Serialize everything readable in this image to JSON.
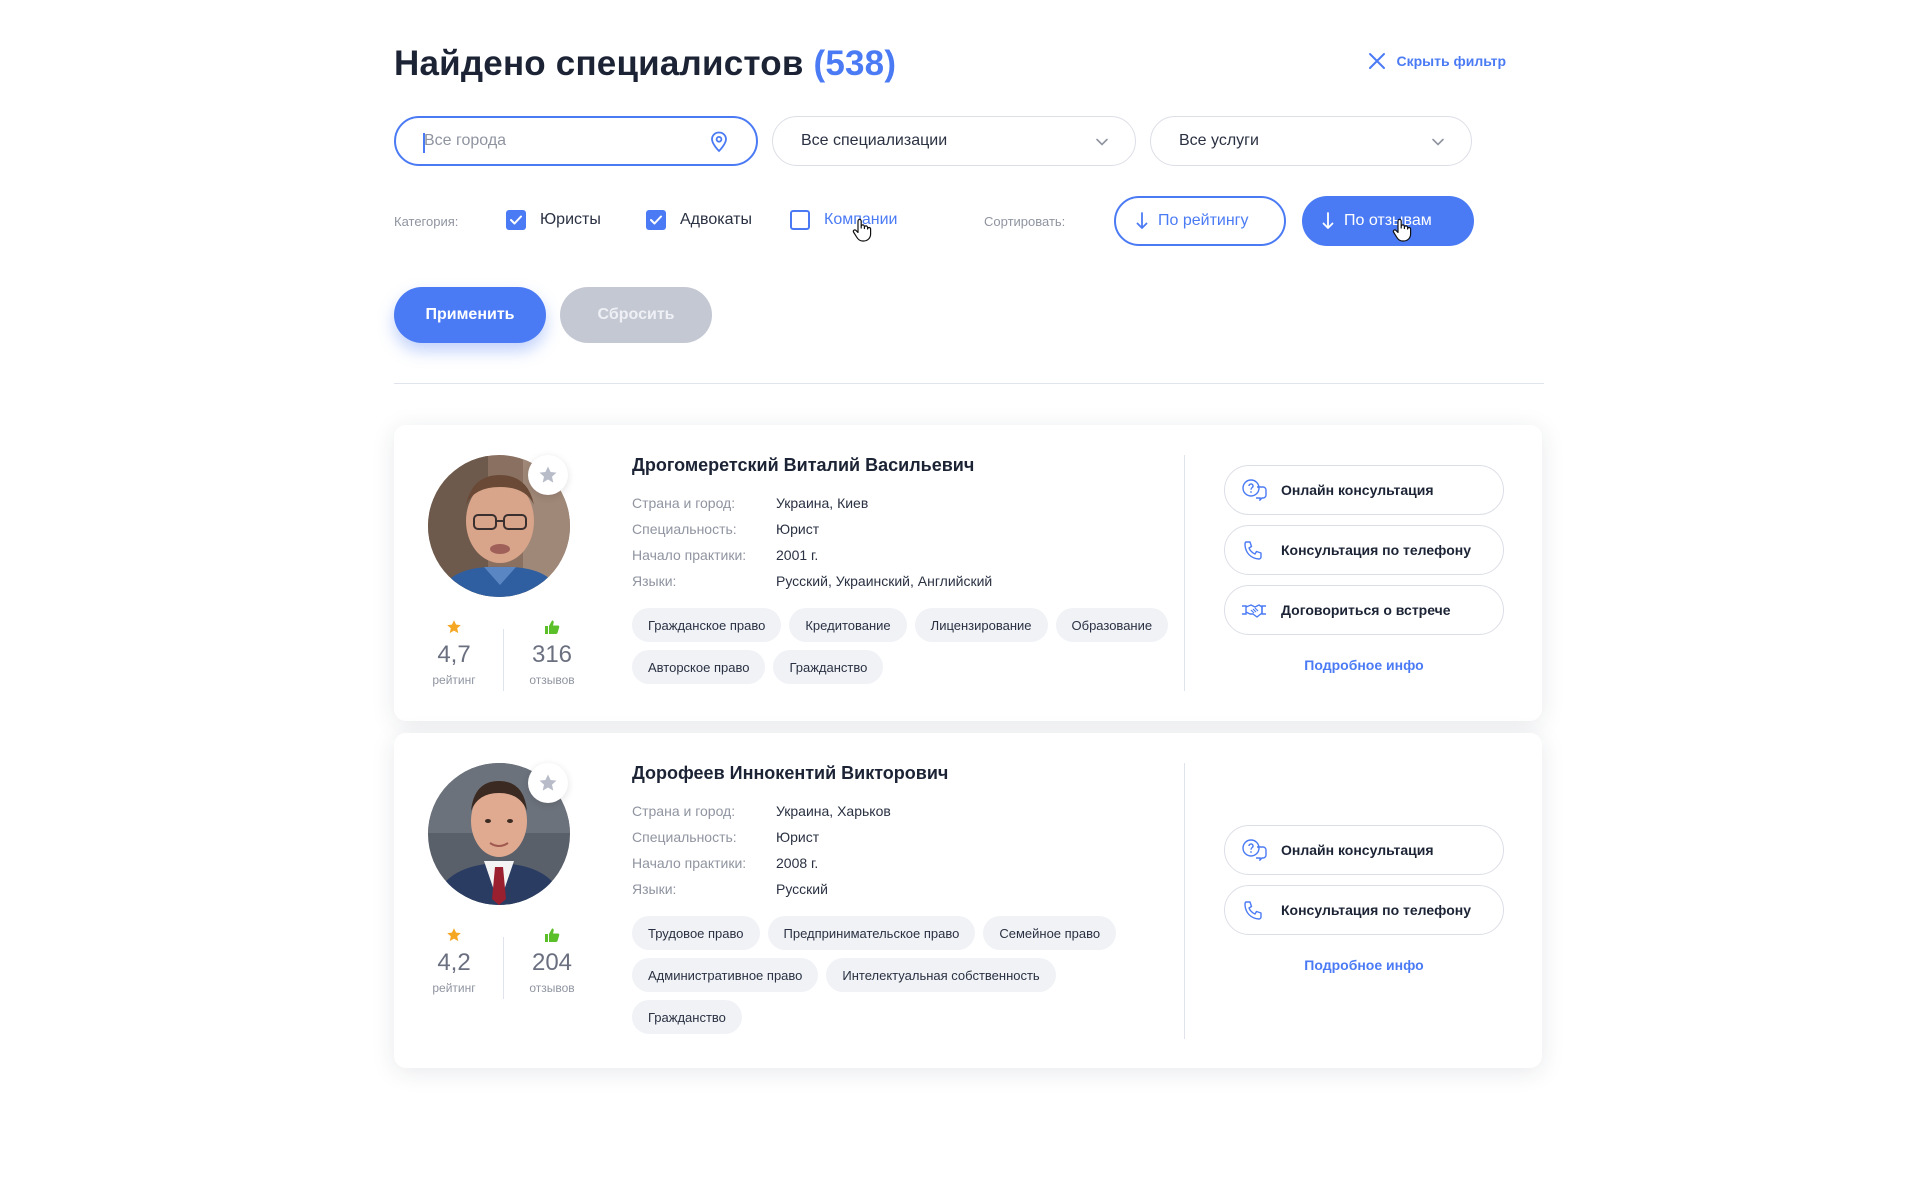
{
  "header": {
    "title": "Найдено специалистов",
    "count": "(538)",
    "hide_filter": "Скрыть фильтр"
  },
  "filters": {
    "city_placeholder": "Все города",
    "specialization": "Все специализации",
    "services": "Все услуги",
    "category_label": "Категория:",
    "categories": [
      {
        "label": "Юристы",
        "checked": true
      },
      {
        "label": "Адвокаты",
        "checked": true
      },
      {
        "label": "Компании",
        "checked": false
      }
    ],
    "sort_label": "Сортировать:",
    "sort_rating": "По рейтингу",
    "sort_reviews": "По отзывам",
    "apply": "Применить",
    "reset": "Сбросить"
  },
  "colors": {
    "accent": "#4b7bf4",
    "text": "#1b2335",
    "muted": "#8f94a0",
    "star": "#f5a623",
    "thumb": "#5bbf2a"
  },
  "specialists": [
    {
      "name": "Дрогомеретский Виталий Васильевич",
      "labels": {
        "location": "Страна и город:",
        "specialty": "Специальность:",
        "start": "Начало практики:",
        "languages": "Языки:"
      },
      "location": "Украина, Киев",
      "specialty": "Юрист",
      "start": "2001 г.",
      "languages": "Русский, Украинский, Английский",
      "rating": "4,7",
      "rating_label": "рейтинг",
      "reviews": "316",
      "reviews_label": "отзывов",
      "tags": [
        "Гражданское право",
        "Кредитование",
        "Лицензирование",
        "Образование",
        "Авторское право",
        "Гражданство"
      ],
      "actions": [
        "Онлайн консультация",
        "Консультация по телефону",
        "Договориться о встрече"
      ],
      "more": "Подробное инфо"
    },
    {
      "name": "Дорофеев Иннокентий Викторович",
      "labels": {
        "location": "Страна и город:",
        "specialty": "Специальность:",
        "start": "Начало практики:",
        "languages": "Языки:"
      },
      "location": "Украина, Харьков",
      "specialty": "Юрист",
      "start": "2008 г.",
      "languages": "Русский",
      "rating": "4,2",
      "rating_label": "рейтинг",
      "reviews": "204",
      "reviews_label": "отзывов",
      "tags": [
        "Трудовое право",
        "Предпринимательское право",
        "Семейное право",
        "Административное право",
        "Интелектуальная собственность",
        "Гражданство"
      ],
      "actions": [
        "Онлайн консультация",
        "Консультация по телефону"
      ],
      "more": "Подробное инфо"
    }
  ]
}
